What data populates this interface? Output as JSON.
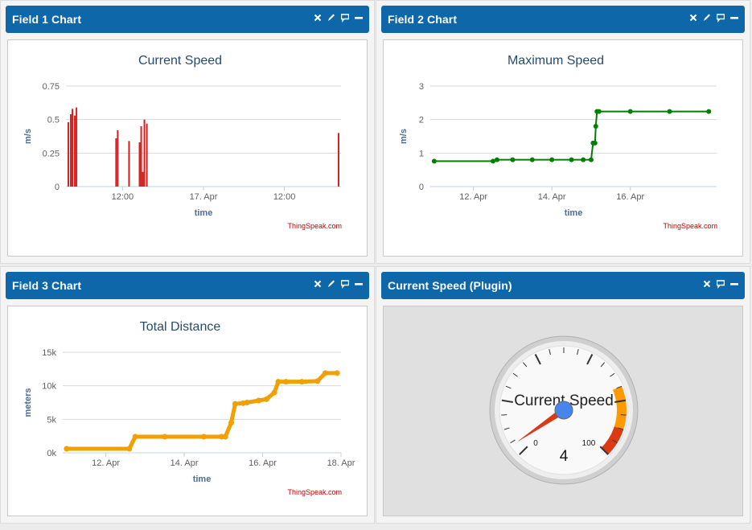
{
  "panels": [
    {
      "title": "Field 1 Chart"
    },
    {
      "title": "Field 2 Chart"
    },
    {
      "title": "Field 3 Chart"
    },
    {
      "title": "Current Speed (Plugin)"
    }
  ],
  "credit": "ThingSpeak.com",
  "colors": {
    "header": "#0d67a8",
    "bar": "#d62020",
    "line2": "#008000",
    "line3": "#f0a000",
    "axis_title": "#4a6c96"
  },
  "chart_data": [
    {
      "type": "bar",
      "title": "Current Speed",
      "xlabel": "time",
      "ylabel": "m/s",
      "ylim": [
        0,
        0.75
      ],
      "yticks": [
        "0",
        "0.25",
        "0.5",
        "0.75"
      ],
      "xticks": [
        {
          "at": 1.7,
          "label": "12:00"
        },
        {
          "at": 2.7,
          "label": "17. Apr"
        },
        {
          "at": 3.7,
          "label": "12:00"
        }
      ],
      "xlim": [
        1.0,
        4.4
      ],
      "x": [
        1.03,
        1.06,
        1.08,
        1.11,
        1.13,
        1.62,
        1.64,
        1.78,
        1.91,
        1.93,
        1.95,
        1.97,
        2.0,
        4.37
      ],
      "values": [
        0.48,
        0.54,
        0.58,
        0.53,
        0.59,
        0.36,
        0.42,
        0.34,
        0.33,
        0.45,
        0.11,
        0.5,
        0.47,
        0.4
      ],
      "grid": true
    },
    {
      "type": "line",
      "title": "Maximum Speed",
      "xlabel": "time",
      "ylabel": "m/s",
      "ylim": [
        0,
        3
      ],
      "yticks": [
        "0",
        "1",
        "2",
        "3"
      ],
      "xticks": [
        {
          "at": 12,
          "label": "12. Apr"
        },
        {
          "at": 14,
          "label": "14. Apr"
        },
        {
          "at": 16,
          "label": "16. Apr"
        }
      ],
      "xlim": [
        10.9,
        18.2
      ],
      "x": [
        11.0,
        12.5,
        12.6,
        13.0,
        13.5,
        14.0,
        14.5,
        14.8,
        15.0,
        15.05,
        15.1,
        15.12,
        15.15,
        15.2,
        16.0,
        17.0,
        18.0
      ],
      "y": [
        0.76,
        0.76,
        0.8,
        0.8,
        0.8,
        0.8,
        0.8,
        0.8,
        0.8,
        1.3,
        1.3,
        1.8,
        2.24,
        2.24,
        2.24,
        2.24,
        2.24
      ],
      "grid": true
    },
    {
      "type": "line",
      "title": "Total Distance",
      "xlabel": "time",
      "ylabel": "meters",
      "ylim": [
        0,
        15000
      ],
      "yticks": [
        "0k",
        "5k",
        "10k",
        "15k"
      ],
      "xticks": [
        {
          "at": 12,
          "label": "12. Apr"
        },
        {
          "at": 14,
          "label": "14. Apr"
        },
        {
          "at": 16,
          "label": "16. Apr"
        },
        {
          "at": 18,
          "label": "18. Apr"
        }
      ],
      "xlim": [
        10.9,
        18.0
      ],
      "x": [
        11.0,
        12.6,
        12.75,
        13.5,
        14.5,
        14.95,
        15.05,
        15.2,
        15.3,
        15.5,
        15.6,
        15.9,
        16.1,
        16.3,
        16.4,
        16.6,
        17.0,
        17.4,
        17.6,
        17.9
      ],
      "y": [
        600,
        600,
        2400,
        2400,
        2400,
        2400,
        2400,
        4500,
        7300,
        7400,
        7500,
        7800,
        8000,
        9000,
        10600,
        10600,
        10600,
        10700,
        11900,
        11900
      ],
      "grid": true
    },
    {
      "type": "gauge",
      "title": "Current Speed",
      "value": 4,
      "min_label": "0",
      "max_label": "100",
      "min": 0,
      "max": 100
    }
  ]
}
